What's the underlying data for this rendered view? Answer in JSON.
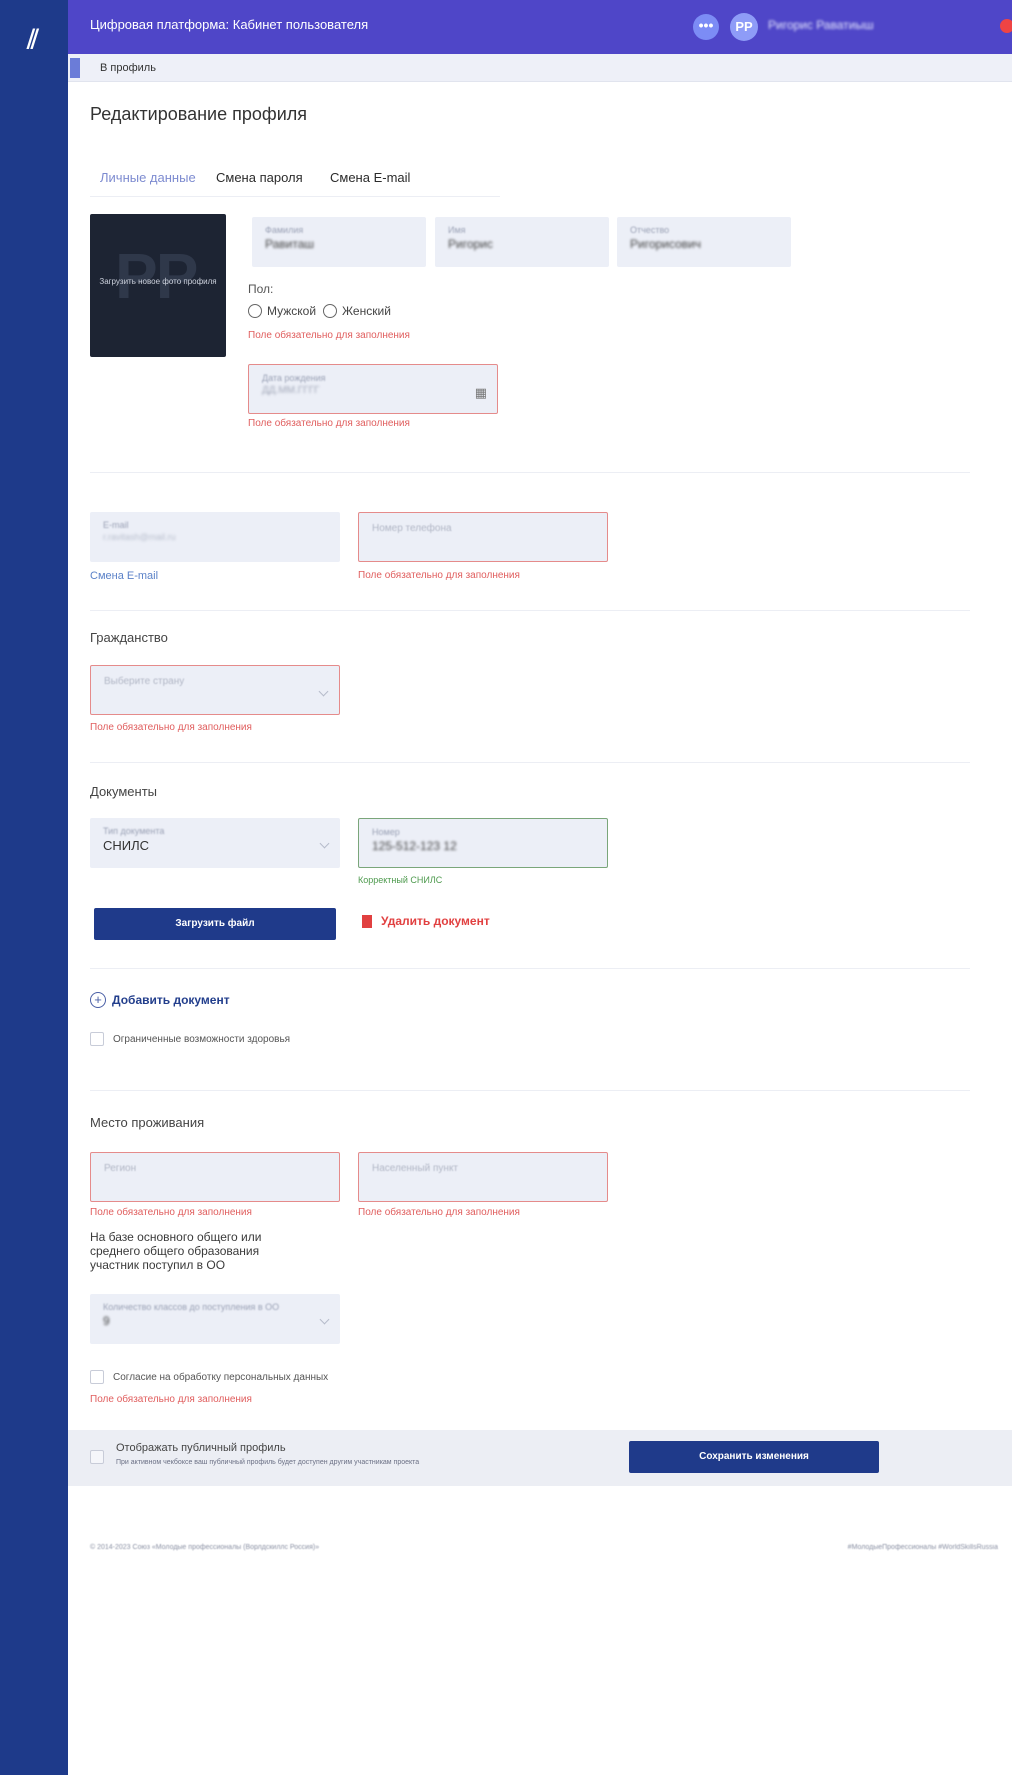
{
  "colors": {
    "sidebar": "#1e3a8a",
    "topbar": "#4f46c8",
    "error": "#e05d5d",
    "success": "#4e9a4e",
    "primary_button": "#1f3a8a"
  },
  "topbar": {
    "app_title": "Цифровая платформа: Кабинет пользователя",
    "more_icon": "more-dots-icon",
    "more_label": "•••",
    "avatar_initials": "PP",
    "user_name": "Ригорис Раватиыш"
  },
  "breadcrumb": {
    "back_label": "В профиль"
  },
  "page_title": "Редактирование профиля",
  "tabs": [
    {
      "label": "Личные данные",
      "active": true
    },
    {
      "label": "Смена пароля",
      "active": false
    },
    {
      "label": "Смена E-mail",
      "active": false
    }
  ],
  "photo": {
    "initials": "PP",
    "upload_label": "Загрузить новое фото профиля"
  },
  "name_fields": {
    "last_name": {
      "label": "Фамилия",
      "value": "Равиташ"
    },
    "first_name": {
      "label": "Имя",
      "value": "Ригорис"
    },
    "middle_name": {
      "label": "Отчество",
      "value": "Ригорисович"
    }
  },
  "gender": {
    "label": "Пол:",
    "options": [
      "Мужской",
      "Женский"
    ],
    "error": "Поле обязательно для заполнения"
  },
  "birth_date": {
    "label": "Дата рождения",
    "placeholder": "ДД.ММ.ГГГГ",
    "icon": "calendar-icon",
    "error": "Поле обязательно для заполнения"
  },
  "contacts": {
    "email": {
      "label": "E-mail",
      "value": "r.ravitash@mail.ru"
    },
    "email_change_link": "Смена E-mail",
    "phone": {
      "placeholder": "Номер телефона",
      "error": "Поле обязательно для заполнения"
    }
  },
  "citizenship": {
    "title": "Гражданство",
    "placeholder": "Выберите страну",
    "error": "Поле обязательно для заполнения"
  },
  "documents": {
    "title": "Документы",
    "type": {
      "label": "Тип документа",
      "value": "СНИЛС"
    },
    "number": {
      "label": "Номер",
      "value": "125-512-123 12",
      "hint": "Корректный СНИЛС"
    },
    "upload_button": "Загрузить файл",
    "delete_label": "Удалить документ",
    "add_label": "Добавить документ"
  },
  "health": {
    "label": "Ограниченные возможности здоровья"
  },
  "residence": {
    "title": "Место проживания",
    "region": {
      "placeholder": "Регион",
      "error": "Поле обязательно для заполнения"
    },
    "locality": {
      "placeholder": "Населенный пункт",
      "error": "Поле обязательно для заполнения"
    },
    "education_text": "На базе основного общего или среднего общего образования участник поступил в ОО",
    "classes": {
      "label": "Количество классов до поступления в ОО",
      "value": "9"
    }
  },
  "consent": {
    "label": "Согласие на обработку персональных данных",
    "error": "Поле обязательно для заполнения"
  },
  "public_profile": {
    "title": "Отображать публичный профиль",
    "subtitle": "При активном чекбоксе ваш публичный профиль будет доступен другим участникам проекта"
  },
  "save_button": "Сохранить изменения",
  "footer": {
    "left": "© 2014-2023 Союз «Молодые профессионалы (Ворлдскиллс Россия)»",
    "right": "#МолодыеПрофессионалы #WorldSkillsRussia"
  }
}
